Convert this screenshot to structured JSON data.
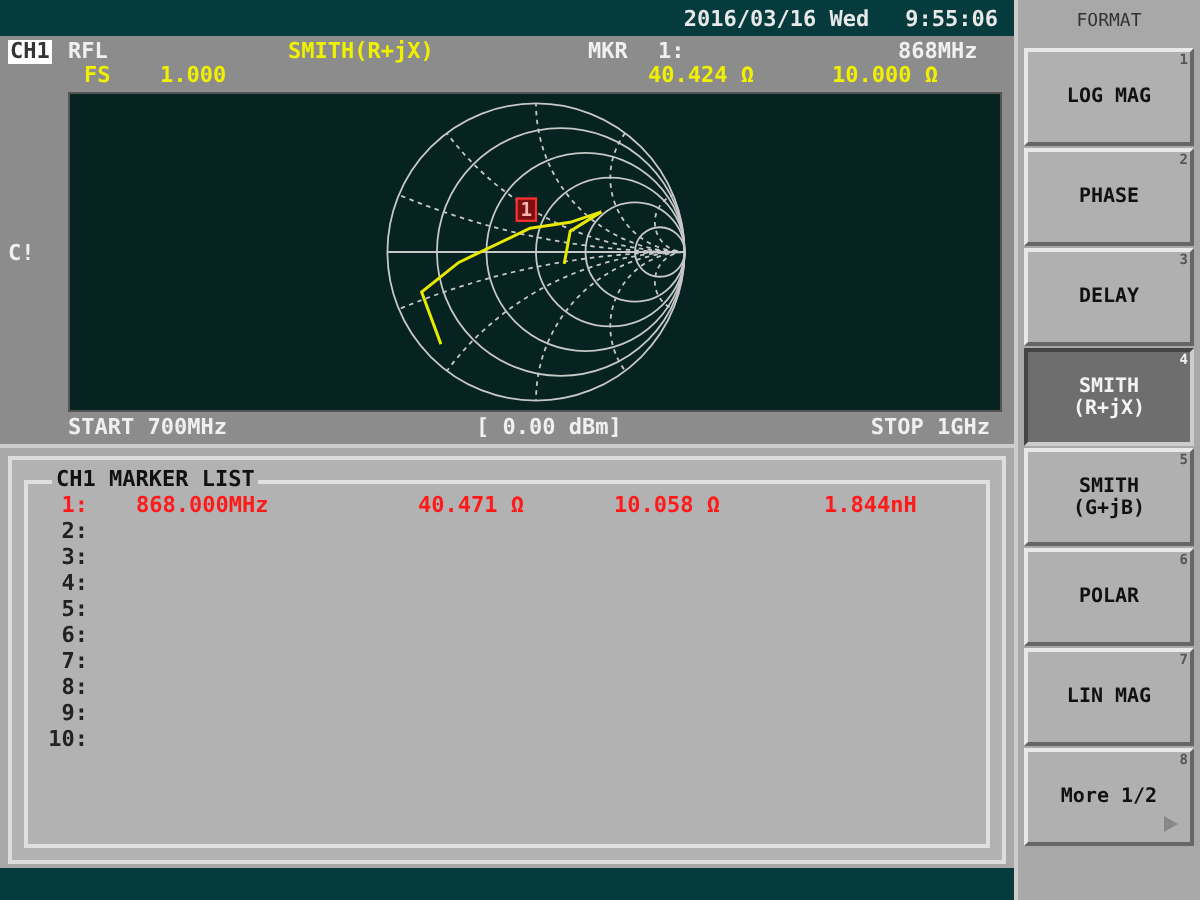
{
  "status_bar": {
    "datetime": "2016/03/16 Wed",
    "time": "9:55:06"
  },
  "header": {
    "channel": "CH1",
    "measurement": "RFL",
    "format": "SMITH(R+jX)",
    "marker_label": "MKR",
    "marker_number": "1:",
    "marker_freq": "868MHz",
    "scale_label": "FS",
    "scale_value": "1.000",
    "marker_r": "40.424 Ω",
    "marker_x": "10.000 Ω"
  },
  "side_label": "C!",
  "chart": {
    "marker_flag": "1"
  },
  "footer": {
    "start": "START 700MHz",
    "power": "[ 0.00 dBm]",
    "stop": "STOP 1GHz"
  },
  "marker_list": {
    "title": "CH1 MARKER LIST",
    "rows": [
      {
        "number": "1:",
        "freq": "868.000MHz",
        "r": "40.471 Ω",
        "x": "10.058 Ω",
        "l": "1.844nH",
        "active": true
      },
      {
        "number": "2:",
        "active": false
      },
      {
        "number": "3:",
        "active": false
      },
      {
        "number": "4:",
        "active": false
      },
      {
        "number": "5:",
        "active": false
      },
      {
        "number": "6:",
        "active": false
      },
      {
        "number": "7:",
        "active": false
      },
      {
        "number": "8:",
        "active": false
      },
      {
        "number": "9:",
        "active": false
      },
      {
        "number": "10:",
        "active": false
      }
    ]
  },
  "softkeys": {
    "title": "FORMAT",
    "keys": [
      {
        "lines": [
          "LOG MAG"
        ],
        "key": "1",
        "selected": false,
        "submenu": false
      },
      {
        "lines": [
          "PHASE"
        ],
        "key": "2",
        "selected": false,
        "submenu": false
      },
      {
        "lines": [
          "DELAY"
        ],
        "key": "3",
        "selected": false,
        "submenu": false
      },
      {
        "lines": [
          "SMITH",
          "(R+jX)"
        ],
        "key": "4",
        "selected": true,
        "submenu": false
      },
      {
        "lines": [
          "SMITH",
          "(G+jB)"
        ],
        "key": "5",
        "selected": false,
        "submenu": false
      },
      {
        "lines": [
          "POLAR"
        ],
        "key": "6",
        "selected": false,
        "submenu": false
      },
      {
        "lines": [
          "LIN MAG"
        ],
        "key": "7",
        "selected": false,
        "submenu": false
      },
      {
        "lines": [
          "More 1/2"
        ],
        "key": "8",
        "selected": false,
        "submenu": true
      }
    ]
  }
}
